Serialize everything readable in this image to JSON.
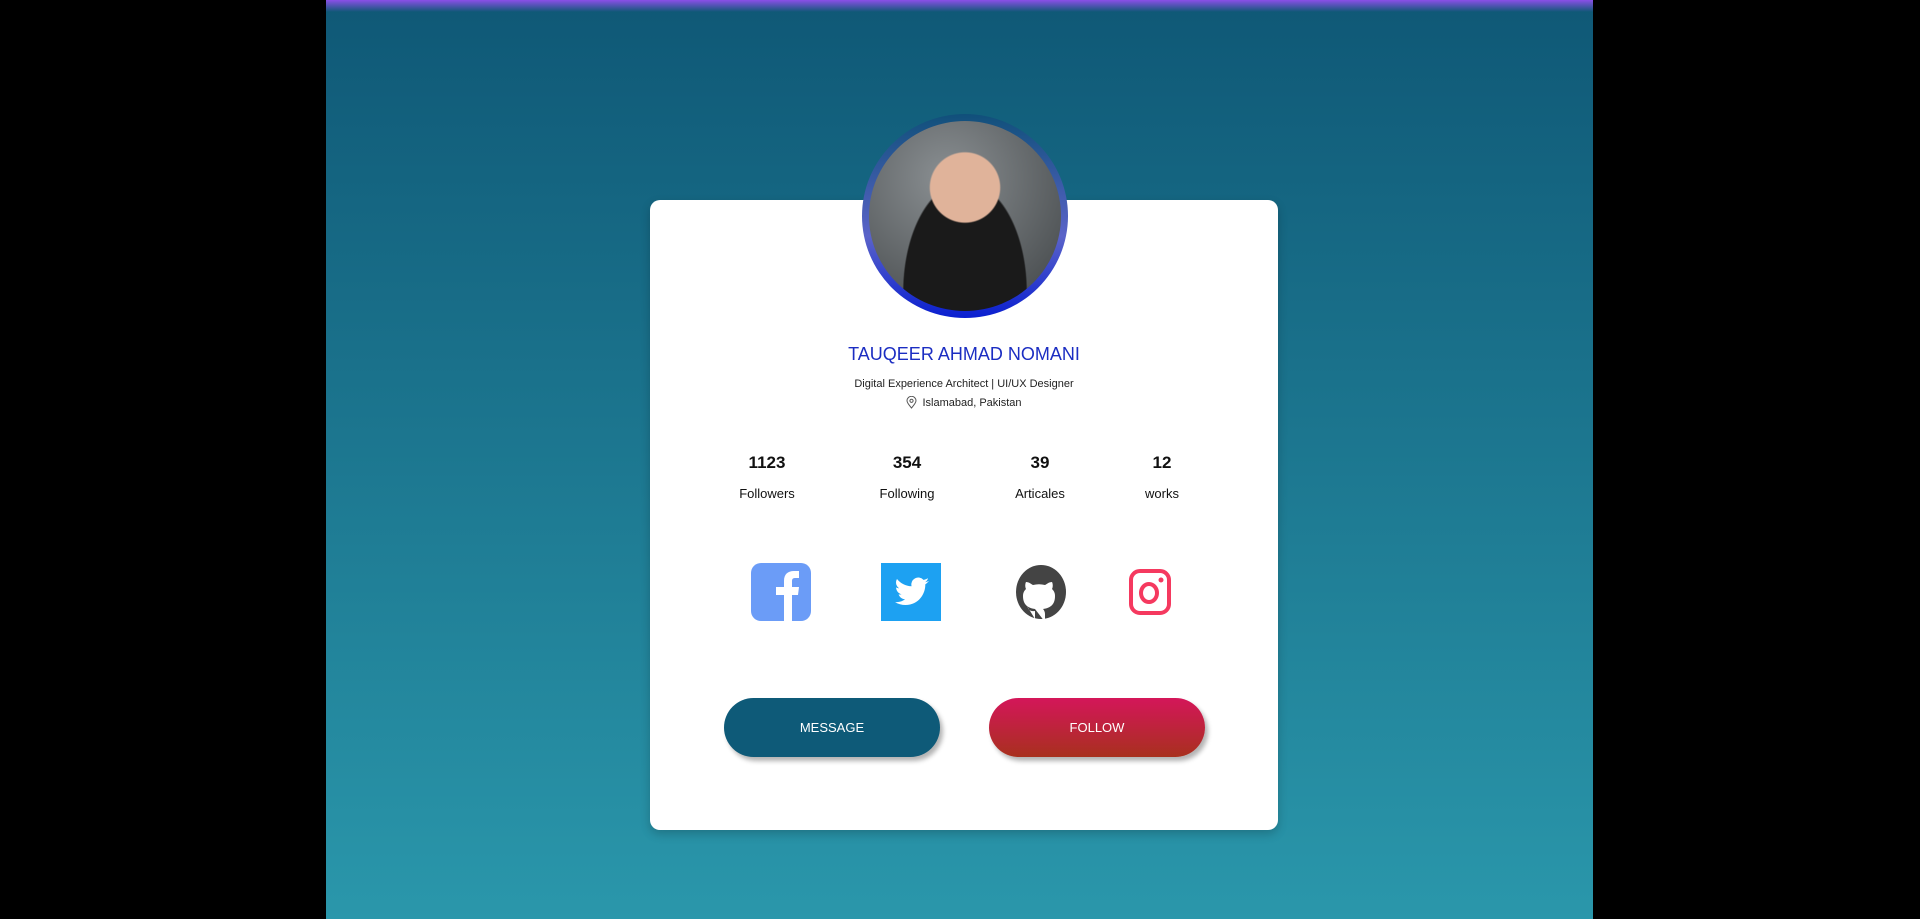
{
  "profile": {
    "name": "TAUQEER AHMAD NOMANI",
    "role": "Digital Experience Architect | UI/UX Designer",
    "location": "Islamabad, Pakistan"
  },
  "stats": [
    {
      "value": "1123",
      "label": "Followers"
    },
    {
      "value": "354",
      "label": "Following"
    },
    {
      "value": "39",
      "label": "Articales"
    },
    {
      "value": "12",
      "label": "works"
    }
  ],
  "social": [
    "facebook-icon",
    "twitter-icon",
    "github-icon",
    "instagram-icon"
  ],
  "buttons": {
    "message": "MESSAGE",
    "follow": "FOLLOW"
  },
  "colors": {
    "name": "#1b2dc2",
    "message": "#0e5a78",
    "follow": "#d4165a",
    "facebook": "#6b9cf7",
    "twitter": "#1da1f2",
    "github": "#444444",
    "instagram": "#f5395f"
  }
}
